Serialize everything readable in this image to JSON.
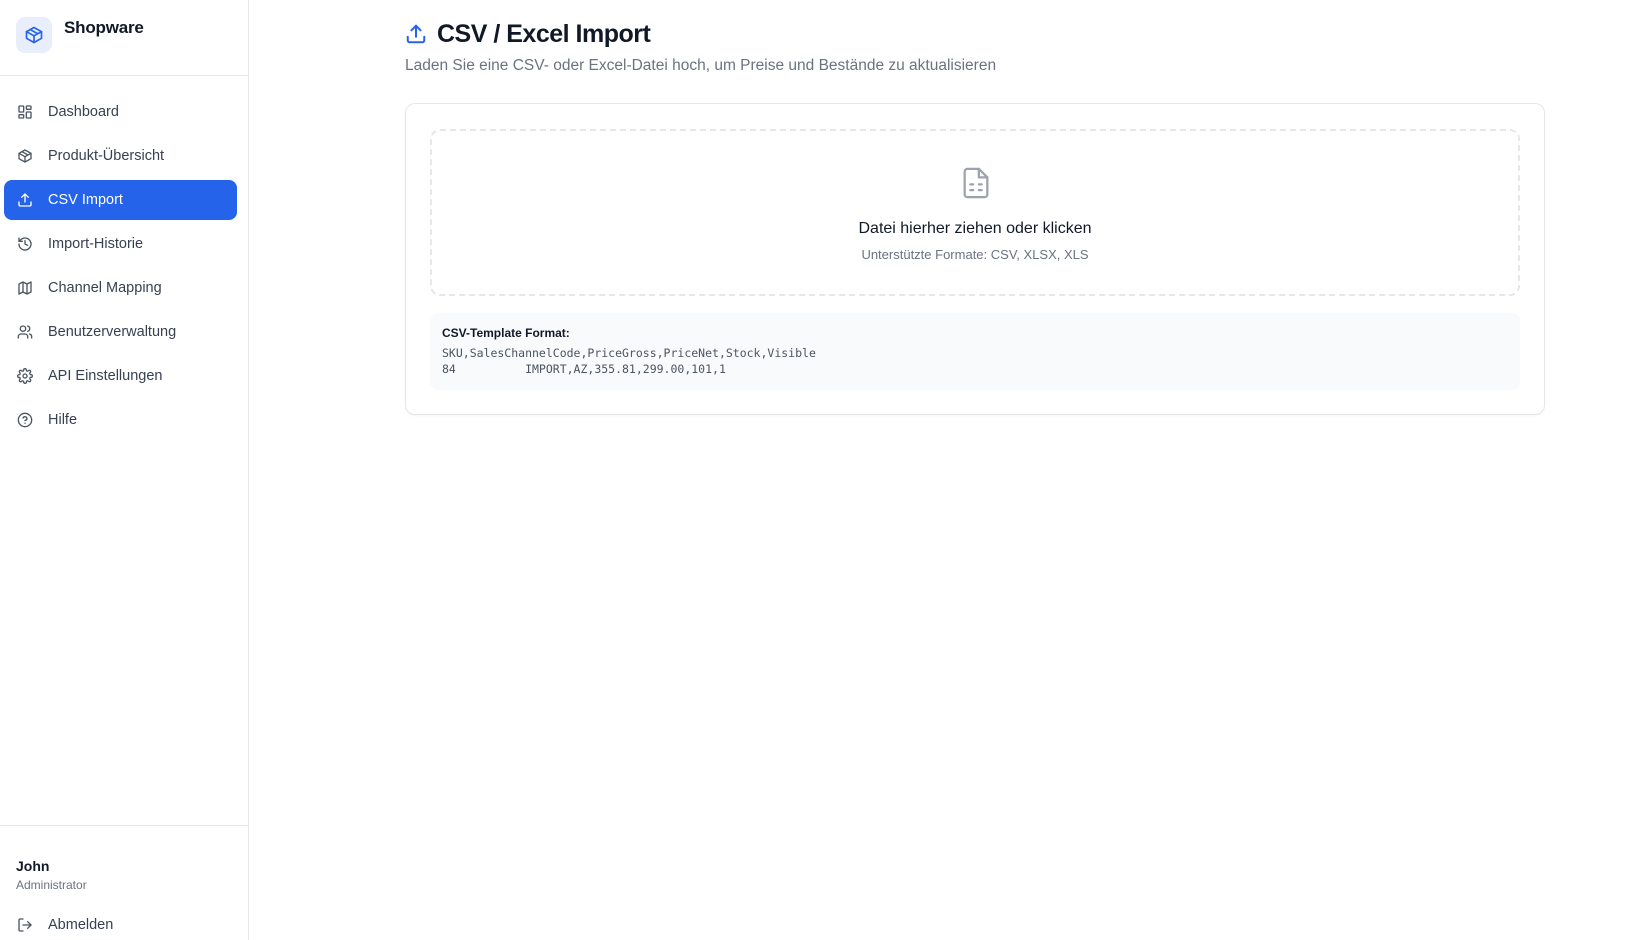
{
  "brand": {
    "name": "Shopware",
    "logo_icon": "box-icon"
  },
  "nav": {
    "items": [
      {
        "label": "Dashboard",
        "icon": "grid-icon",
        "active": false
      },
      {
        "label": "Produkt-Übersicht",
        "icon": "package-icon",
        "active": false
      },
      {
        "label": "CSV Import",
        "icon": "upload-icon",
        "active": true
      },
      {
        "label": "Import-Historie",
        "icon": "history-icon",
        "active": false
      },
      {
        "label": "Channel Mapping",
        "icon": "map-icon",
        "active": false
      },
      {
        "label": "Benutzerverwaltung",
        "icon": "users-icon",
        "active": false
      },
      {
        "label": "API Einstellungen",
        "icon": "gear-icon",
        "active": false
      },
      {
        "label": "Hilfe",
        "icon": "help-circle-icon",
        "active": false
      }
    ]
  },
  "user": {
    "name": "John",
    "role": "Administrator",
    "logout_label": "Abmelden"
  },
  "page": {
    "title": "CSV / Excel Import",
    "subtitle": "Laden Sie eine CSV- oder Excel-Datei hoch, um Preise und Bestände zu aktualisieren"
  },
  "dropzone": {
    "title": "Datei hierher ziehen oder klicken",
    "hint": "Unterstützte Formate: CSV, XLSX, XLS"
  },
  "template": {
    "label": "CSV-Template Format:",
    "header_line": "SKU,SalesChannelCode,PriceGross,PriceNet,Stock,Visible",
    "example_line": "84          IMPORT,AZ,355.81,299.00,101,1"
  },
  "colors": {
    "accent": "#2563eb",
    "border": "#e5e7eb",
    "muted": "#6b7280"
  }
}
